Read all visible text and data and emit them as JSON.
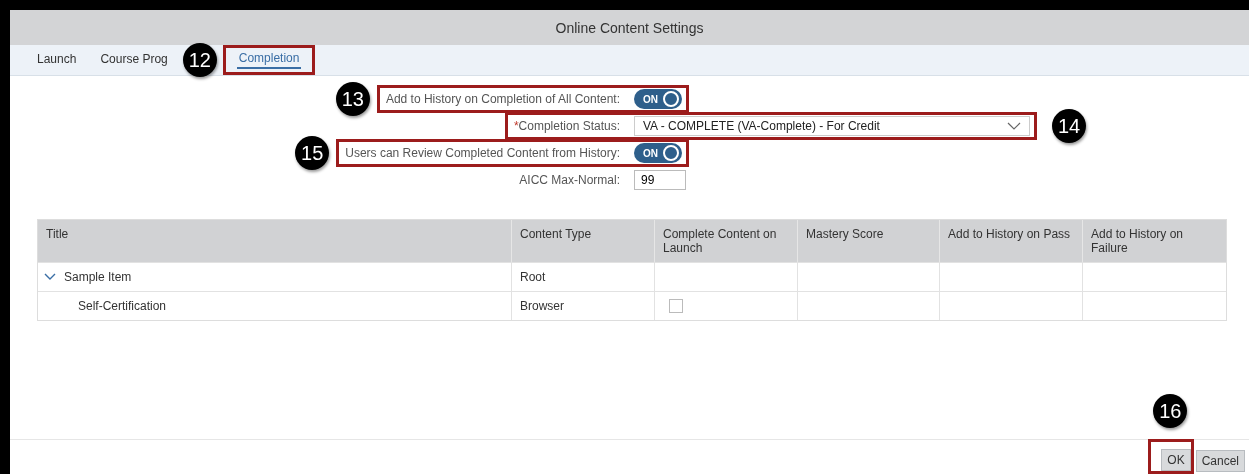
{
  "window": {
    "title": "Online Content Settings"
  },
  "tabs": [
    {
      "label": "Launch",
      "selected": false
    },
    {
      "label": "Course Prog",
      "selected": false
    },
    {
      "label": "Completion",
      "selected": true,
      "callout": "12"
    }
  ],
  "form": [
    {
      "kind": "toggle",
      "label": "Add to History on Completion of All Content:",
      "on": true,
      "on_text": "ON",
      "callout": "13"
    },
    {
      "kind": "dropdown",
      "label": "Completion Status:",
      "required_mark": "*",
      "value": "VA - COMPLETE (VA-Complete) - For Credit",
      "callout": "14"
    },
    {
      "kind": "toggle",
      "label": "Users can Review Completed Content from History:",
      "on": true,
      "on_text": "ON",
      "callout": "15"
    },
    {
      "kind": "input",
      "label": "AICC Max-Normal:",
      "value": "99"
    }
  ],
  "table": {
    "columns": [
      "Title",
      "Content Type",
      "Complete Content on Launch",
      "Mastery Score",
      "Add to History on Pass",
      "Add to History on Failure"
    ],
    "rows": [
      {
        "title": "Sample Item",
        "content_type": "Root",
        "expanded": true,
        "children": [
          {
            "title": "Self-Certification",
            "content_type": "Browser",
            "complete_on_launch": {
              "checked": false
            }
          }
        ]
      }
    ]
  },
  "buttons": [
    {
      "label": "OK",
      "callout": "16"
    },
    {
      "label": "Cancel"
    }
  ]
}
